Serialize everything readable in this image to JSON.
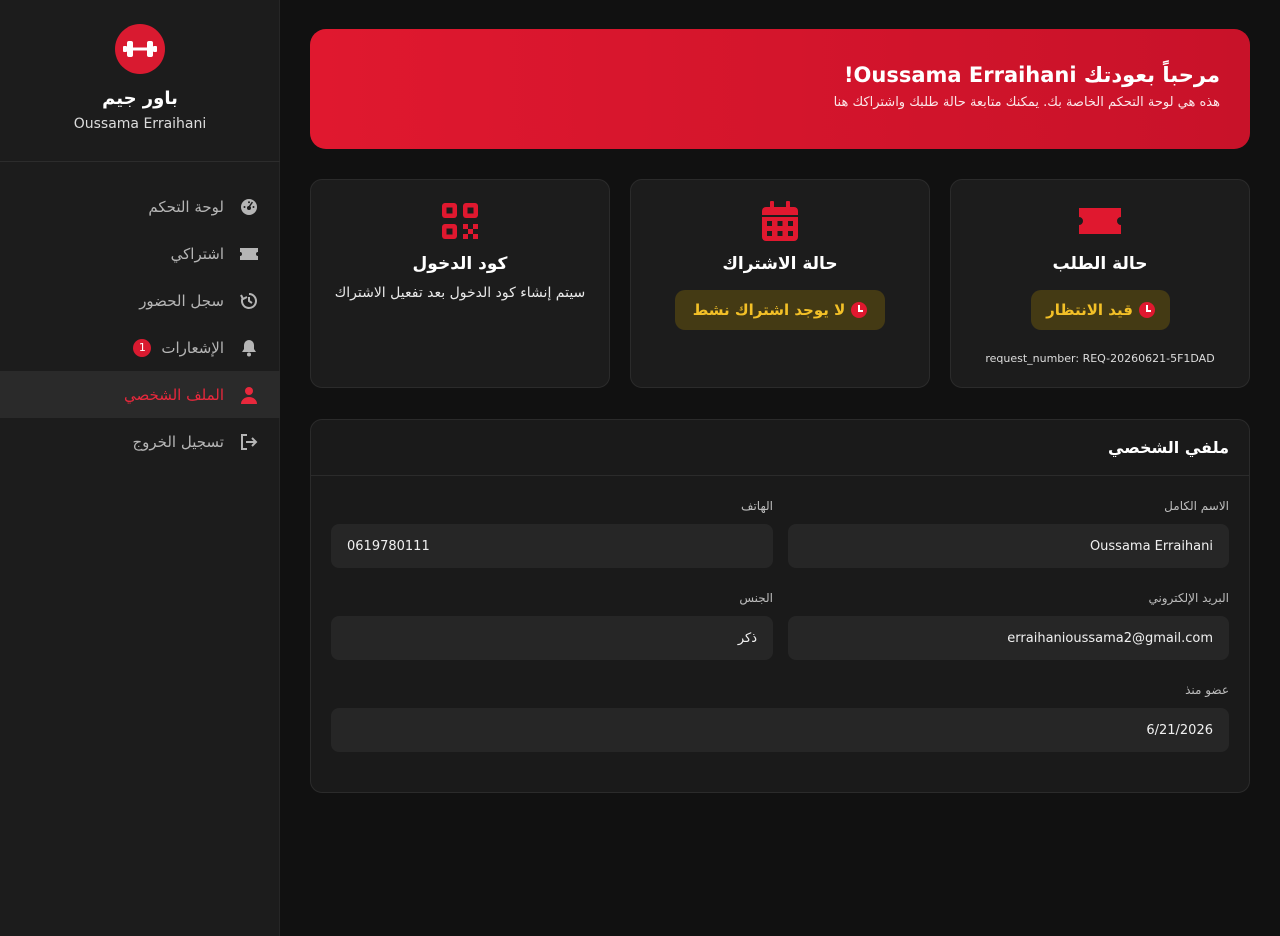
{
  "brand": {
    "name": "باور جيم",
    "user": "Oussama Erraihani"
  },
  "nav": [
    {
      "label": "لوحة التحكم",
      "icon": "dashboard-icon"
    },
    {
      "label": "اشتراكي",
      "icon": "ticket-icon"
    },
    {
      "label": "سجل الحضور",
      "icon": "history-icon"
    },
    {
      "label": "الإشعارات",
      "icon": "bell-icon",
      "badge": "1"
    },
    {
      "label": "الملف الشخصي",
      "icon": "user-icon",
      "active": true
    },
    {
      "label": "تسجيل الخروج",
      "icon": "logout-icon"
    }
  ],
  "banner": {
    "title": "مرحباً بعودتك Oussama Erraihani!",
    "subtitle": "هذه هي لوحة التحكم الخاصة بك. يمكنك متابعة حالة طلبك واشتراكك هنا"
  },
  "cards": {
    "request": {
      "title": "حالة الطلب",
      "status": "قيد الانتظار",
      "request_number": "request_number: REQ-20260621-5F1DAD"
    },
    "subscription": {
      "title": "حالة الاشتراك",
      "status": "لا يوجد اشتراك نشط"
    },
    "access_code": {
      "title": "كود الدخول",
      "text": "سيتم إنشاء كود الدخول بعد تفعيل الاشتراك"
    }
  },
  "profile": {
    "title": "ملفي الشخصي",
    "full_name_label": "الاسم الكامل",
    "full_name": "Oussama Erraihani",
    "phone_label": "الهاتف",
    "phone": "0619780111",
    "email_label": "البريد الإلكتروني",
    "email": "erraihanioussama2@gmail.com",
    "gender_label": "الجنس",
    "gender": "ذكر",
    "member_since_label": "عضو منذ",
    "member_since": "6/21/2026"
  },
  "colors": {
    "accent": "#e0182f",
    "warning_bg": "#443a14",
    "warning_text": "#f3c027"
  }
}
